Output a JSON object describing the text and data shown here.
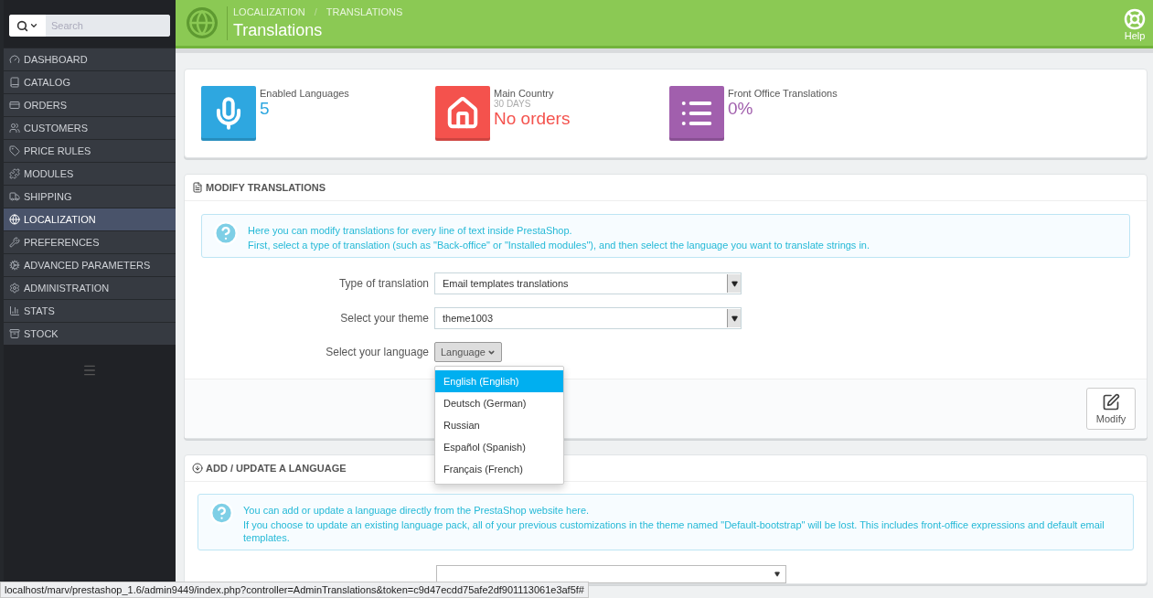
{
  "sidebar": {
    "search": {
      "placeholder": "Search"
    },
    "items": [
      {
        "label": "DASHBOARD",
        "selected": false
      },
      {
        "label": "CATALOG",
        "selected": false
      },
      {
        "label": "ORDERS",
        "selected": false
      },
      {
        "label": "CUSTOMERS",
        "selected": false
      },
      {
        "label": "PRICE RULES",
        "selected": false
      },
      {
        "label": "MODULES",
        "selected": false
      },
      {
        "label": "SHIPPING",
        "selected": false
      },
      {
        "label": "LOCALIZATION",
        "selected": true
      },
      {
        "label": "PREFERENCES",
        "selected": false
      },
      {
        "label": "ADVANCED PARAMETERS",
        "selected": false
      },
      {
        "label": "ADMINISTRATION",
        "selected": false
      },
      {
        "label": "STATS",
        "selected": false
      },
      {
        "label": "STOCK",
        "selected": false
      }
    ]
  },
  "header": {
    "breadcrumb": [
      "LOCALIZATION",
      "TRANSLATIONS"
    ],
    "breadcrumb_separator": "/",
    "title": "Translations",
    "help": "Help"
  },
  "stats": [
    {
      "label": "Enabled Languages",
      "value": "5",
      "color": "#2ea7e0"
    },
    {
      "label": "Main Country",
      "sublabel": "30 DAYS",
      "value": "No orders",
      "color": "#f4524d"
    },
    {
      "label": "Front Office Translations",
      "value": "0%",
      "color": "#a15fad"
    }
  ],
  "modify_panel": {
    "title": "MODIFY TRANSLATIONS",
    "info": [
      "Here you can modify translations for every line of text inside PrestaShop.",
      "First, select a type of translation (such as \"Back-office\" or \"Installed modules\"), and then select the language you want to translate strings in."
    ],
    "fields": [
      {
        "label": "Type of translation",
        "value": "Email templates translations"
      },
      {
        "label": "Select your theme",
        "value": "theme1003"
      }
    ],
    "language": {
      "label": "Select your language",
      "button": "Language",
      "expanded": true,
      "options": [
        {
          "label": "English (English)",
          "selected": true
        },
        {
          "label": "Deutsch (German)",
          "selected": false
        },
        {
          "label": "Russian",
          "selected": false
        },
        {
          "label": "Español (Spanish)",
          "selected": false
        },
        {
          "label": "Français (French)",
          "selected": false
        }
      ]
    },
    "modify_button": "Modify"
  },
  "add_panel": {
    "title": "ADD / UPDATE A LANGUAGE",
    "info": [
      "You can add or update a language directly from the PrestaShop website here.",
      "If you choose to update an existing language pack, all of your previous customizations in the theme named \"Default-bootstrap\" will be lost. This includes front-office expressions and default email templates."
    ]
  },
  "status_bar": "localhost/marv/prestashop_1.6/admin9449/index.php?controller=AdminTranslations&token=c9d47ecdd75afe2df901113061e3af5f#"
}
